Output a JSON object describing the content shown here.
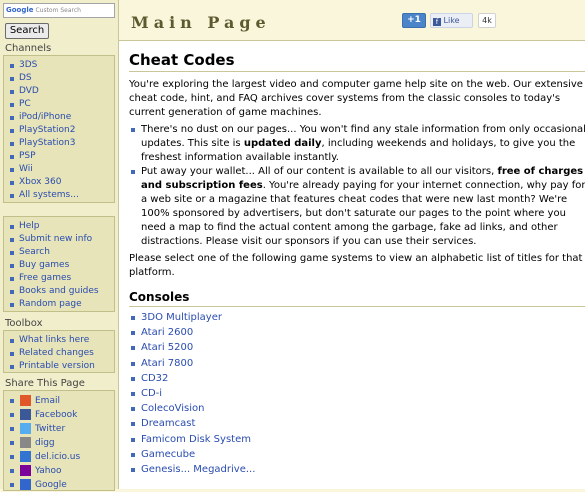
{
  "search": {
    "google_label": "Google",
    "placeholder": "Custom Search",
    "button": "Search"
  },
  "channels": {
    "title": "Channels",
    "items": [
      "3DS",
      "DS",
      "DVD",
      "PC",
      "iPod/iPhone",
      "PlayStation2",
      "PlayStation3",
      "PSP",
      "Wii",
      "Xbox 360",
      "All systems..."
    ]
  },
  "help_links": {
    "items": [
      "Help",
      "Submit new info",
      "Search",
      "Buy games",
      "Free games",
      "Books and guides",
      "Random page"
    ]
  },
  "toolbox": {
    "title": "Toolbox",
    "items": [
      "What links here",
      "Related changes",
      "Printable version"
    ]
  },
  "share": {
    "title": "Share This Page",
    "items": [
      {
        "label": "Email",
        "icon": "email-icon",
        "color": "#e0582a"
      },
      {
        "label": "Facebook",
        "icon": "facebook-icon",
        "color": "#3b5998"
      },
      {
        "label": "Twitter",
        "icon": "twitter-icon",
        "color": "#55acee"
      },
      {
        "label": "digg",
        "icon": "digg-icon",
        "color": "#888888"
      },
      {
        "label": "del.icio.us",
        "icon": "delicious-icon",
        "color": "#3274d0"
      },
      {
        "label": "Yahoo",
        "icon": "yahoo-icon",
        "color": "#7b0099"
      },
      {
        "label": "Google",
        "icon": "google-icon",
        "color": "#3366cc"
      }
    ]
  },
  "header": {
    "title": "Main Page",
    "plusone": "+1",
    "like": "Like",
    "like_count": "4k"
  },
  "content": {
    "heading": "Cheat Codes",
    "intro": "You're exploring the largest video and computer game help site on the web. Our extensive cheat code, hint, and FAQ archives cover systems from the classic consoles to today's current generation of game machines.",
    "bullet1_a": "There's no dust on our pages... You won't find any stale information from only occasional updates. This site is ",
    "bullet1_b": "updated daily",
    "bullet1_c": ", including weekends and holidays, to give you the freshest information available instantly.",
    "bullet2_a": "Put away your wallet... All of our content is available to all our visitors, ",
    "bullet2_b": "free of charges and subscription fees",
    "bullet2_c": ". You're already paying for your internet connection, why pay for a web site or a magazine that features cheat codes that were new last month? We're 100% sponsored by advertisers, but don't saturate our pages to the point where you need a map to find the actual content among the garbage, fake ad links, and other distractions. Please visit our sponsors if you can use their services.",
    "select_text": "Please select one of the following game systems to view an alphabetic list of titles for that platform.",
    "consoles_heading": "Consoles",
    "consoles": [
      "3DO Multiplayer",
      "Atari 2600",
      "Atari 5200",
      "Atari 7800",
      "CD32",
      "CD-i",
      "ColecoVision",
      "Dreamcast",
      "Famicom Disk System",
      "Gamecube",
      "Genesis... Megadrive..."
    ]
  },
  "colors": {
    "sidebar_bg": "#f1eecb",
    "box_bg": "#e6e4b8",
    "link": "#2a4cb0",
    "title": "#5d5a30"
  }
}
